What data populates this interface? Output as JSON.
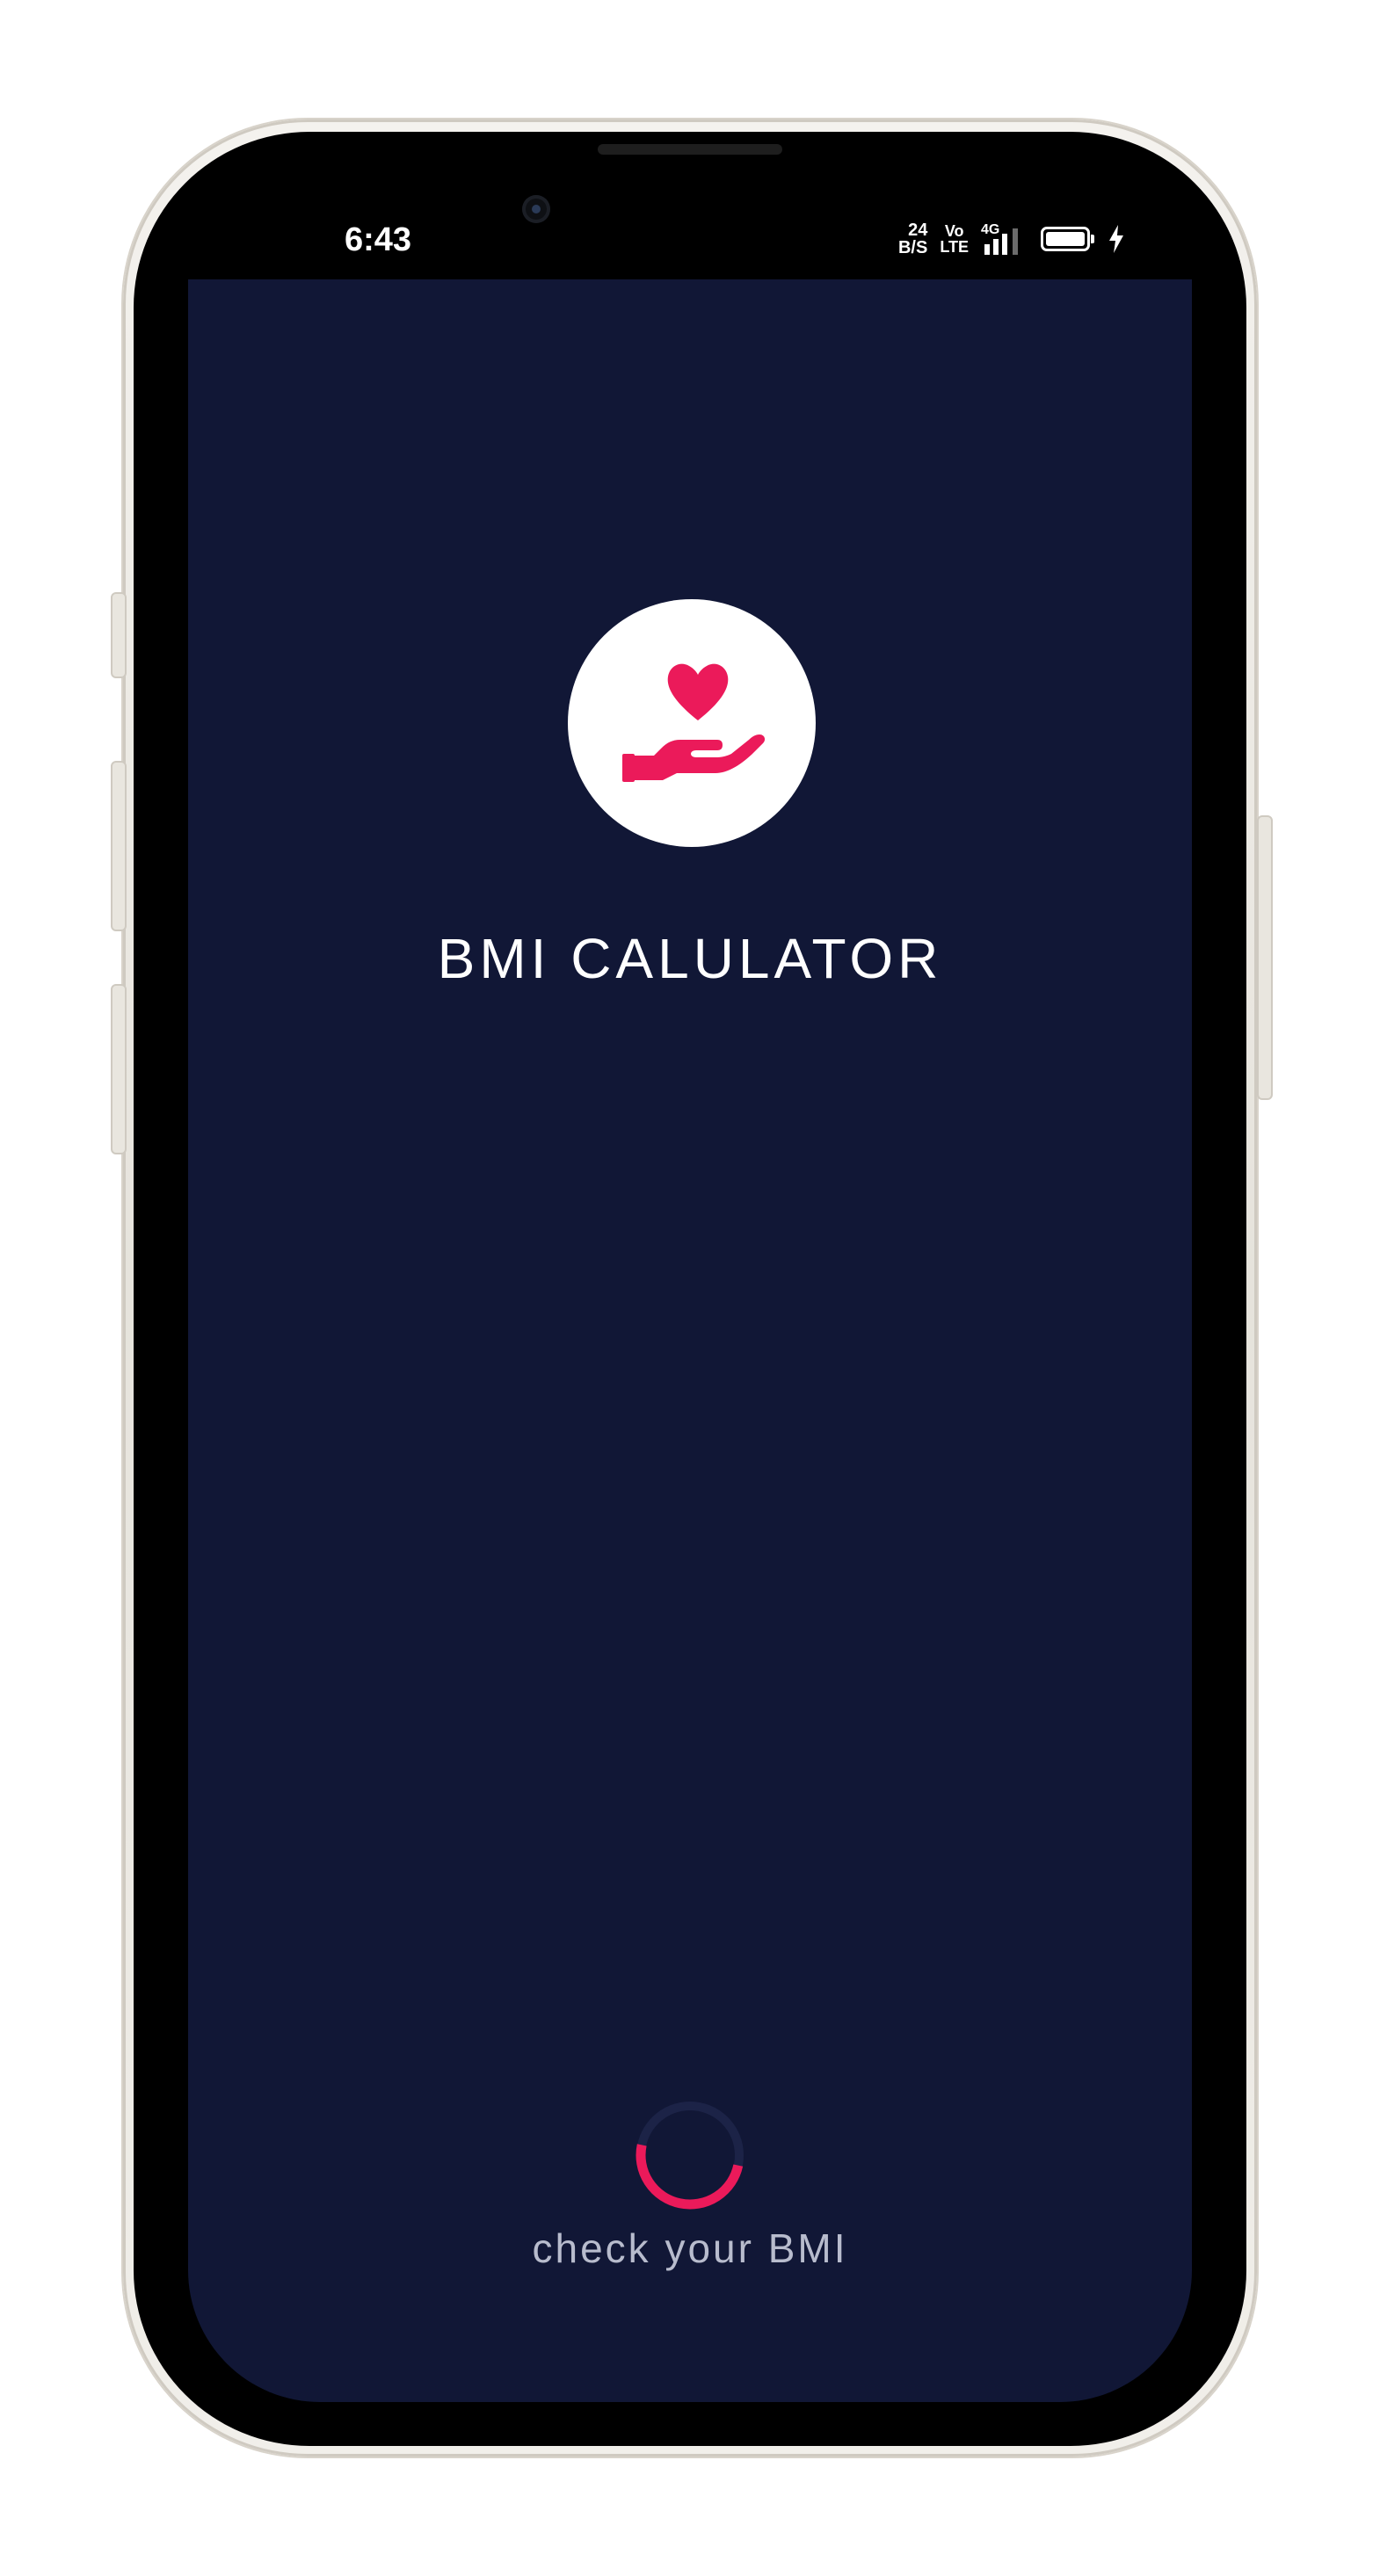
{
  "status_bar": {
    "time": "6:43",
    "net_speed_value": "24",
    "net_speed_unit": "B/S",
    "volte_top": "Vo",
    "volte_bottom": "LTE",
    "network_type": "4G",
    "icons": [
      "signal-icon",
      "battery-icon",
      "charging-icon"
    ]
  },
  "splash": {
    "logo_icon": "heart-in-hand-icon",
    "title": "BMI CALULATOR",
    "tagline": "check your BMI",
    "loading_indicator": "spinner-icon"
  },
  "colors": {
    "background": "#111736",
    "accent": "#eb1a5a",
    "title_text": "#ffffff",
    "tagline_text": "#b8bccd"
  }
}
